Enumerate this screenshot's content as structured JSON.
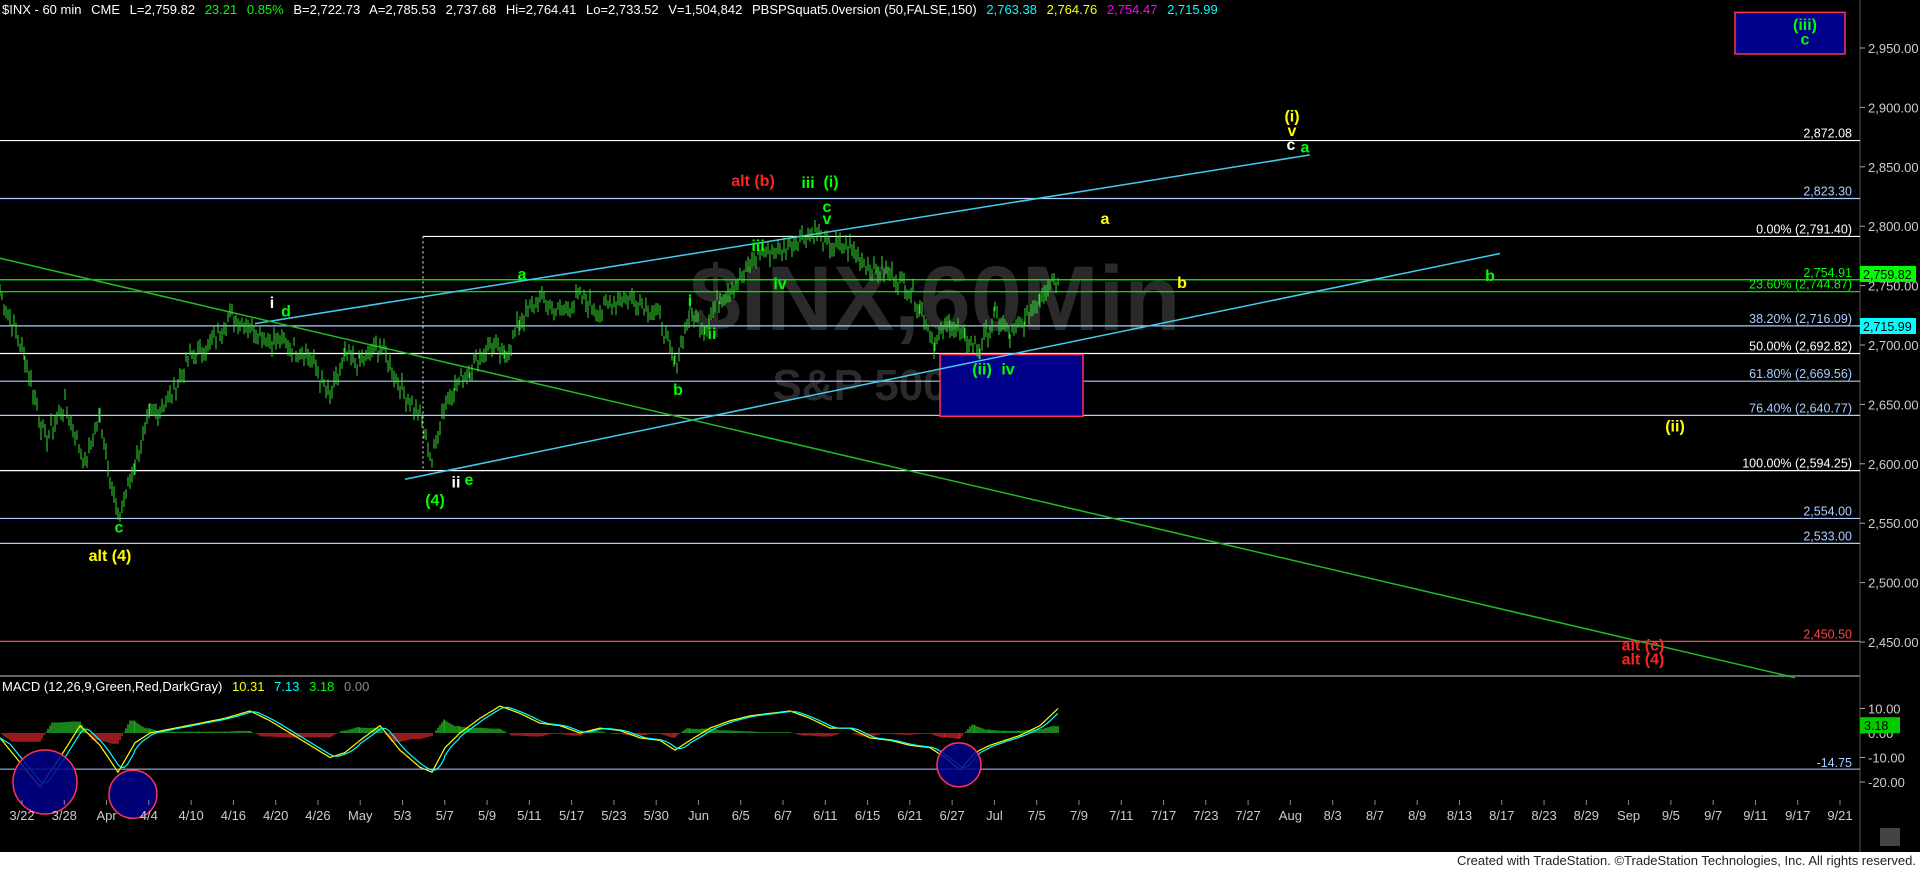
{
  "header": {
    "symbol": "$INX - 60 min",
    "exchange": "CME",
    "last": "L=2,759.82",
    "change": "23.21",
    "change_pct": "0.85%",
    "bid": "B=2,722.73",
    "ask": "A=2,785.53",
    "open": "2,737.68",
    "high": "Hi=2,764.41",
    "low": "Lo=2,733.52",
    "volume": "V=1,504,842",
    "study": "PBSPSquat5.0version (50,FALSE,150)",
    "study_values": [
      "2,763.38",
      "2,764.76",
      "2,754.47",
      "2,715.99"
    ],
    "colors": {
      "symbol": "#ffffff",
      "change": "#00ff00",
      "study1": "#00ffff",
      "study2": "#ffff00",
      "study3": "#ff00ff",
      "study4": "#00ffff"
    }
  },
  "watermark": {
    "line1": "$INX,60Min",
    "line2": "S&P 500"
  },
  "macd_header": {
    "label": "MACD (12,26,9,Green,Red,DarkGray)",
    "values": [
      "10.31",
      "7.13",
      "3.18",
      "0.00"
    ]
  },
  "credit": "Created with TradeStation. ©TradeStation Technologies, Inc. All rights reserved.",
  "chart_data": {
    "type": "line",
    "title": "$INX - 60 min",
    "price_axis": {
      "ticks": [
        2450,
        2500,
        2550,
        2600,
        2650,
        2700,
        2750,
        2800,
        2850,
        2900,
        2950
      ],
      "tick_labels": [
        "2,450.00",
        "2,500.00",
        "2,550.00",
        "2,600.00",
        "2,650.00",
        "2,700.00",
        "2,750.00",
        "2,800.00",
        "2,850.00",
        "2,900.00",
        "2,950.00"
      ],
      "ylim": [
        2435,
        2985
      ]
    },
    "macd_axis": {
      "ticks": [
        10,
        0,
        -10,
        -20
      ],
      "tick_labels": [
        "10.00",
        "0.00",
        "-10.00",
        "-20.00"
      ],
      "ylim": [
        -26,
        14
      ]
    },
    "date_labels": [
      "3/22",
      "3/28",
      "Apr",
      "4/4",
      "4/10",
      "4/16",
      "4/20",
      "4/26",
      "May",
      "5/3",
      "5/7",
      "5/9",
      "5/11",
      "5/17",
      "5/23",
      "5/30",
      "Jun",
      "6/5",
      "6/7",
      "6/11",
      "6/15",
      "6/21",
      "6/27",
      "Jul",
      "7/5",
      "7/9",
      "7/11",
      "7/17",
      "7/23",
      "7/27",
      "Aug",
      "8/3",
      "8/7",
      "8/9",
      "8/13",
      "8/17",
      "8/23",
      "8/29",
      "Sep",
      "9/5",
      "9/7",
      "9/11",
      "9/17",
      "9/21"
    ],
    "price_series": [
      [
        0,
        2745
      ],
      [
        25,
        2690
      ],
      [
        45,
        2620
      ],
      [
        65,
        2650
      ],
      [
        85,
        2600
      ],
      [
        100,
        2640
      ],
      [
        118,
        2553
      ],
      [
        135,
        2600
      ],
      [
        150,
        2640
      ],
      [
        170,
        2655
      ],
      [
        190,
        2690
      ],
      [
        210,
        2700
      ],
      [
        230,
        2725
      ],
      [
        250,
        2716
      ],
      [
        270,
        2705
      ],
      [
        290,
        2700
      ],
      [
        310,
        2690
      ],
      [
        330,
        2655
      ],
      [
        345,
        2690
      ],
      [
        360,
        2685
      ],
      [
        380,
        2700
      ],
      [
        400,
        2665
      ],
      [
        420,
        2640
      ],
      [
        432,
        2602
      ],
      [
        442,
        2645
      ],
      [
        455,
        2665
      ],
      [
        470,
        2680
      ],
      [
        490,
        2700
      ],
      [
        505,
        2690
      ],
      [
        520,
        2720
      ],
      [
        540,
        2740
      ],
      [
        560,
        2727
      ],
      [
        580,
        2740
      ],
      [
        600,
        2728
      ],
      [
        620,
        2740
      ],
      [
        640,
        2738
      ],
      [
        660,
        2722
      ],
      [
        675,
        2682
      ],
      [
        690,
        2728
      ],
      [
        705,
        2715
      ],
      [
        720,
        2740
      ],
      [
        740,
        2755
      ],
      [
        760,
        2778
      ],
      [
        780,
        2780
      ],
      [
        800,
        2790
      ],
      [
        815,
        2795
      ],
      [
        830,
        2782
      ],
      [
        850,
        2782
      ],
      [
        870,
        2765
      ],
      [
        890,
        2760
      ],
      [
        905,
        2752
      ],
      [
        920,
        2732
      ],
      [
        935,
        2700
      ],
      [
        950,
        2720
      ],
      [
        965,
        2705
      ],
      [
        980,
        2697
      ],
      [
        995,
        2725
      ],
      [
        1010,
        2708
      ],
      [
        1025,
        2720
      ],
      [
        1040,
        2742
      ],
      [
        1052,
        2757
      ],
      [
        1058,
        2753
      ]
    ],
    "horizontal_levels": [
      {
        "value": 2872.08,
        "label": "2,872.08",
        "color": "#ffffff"
      },
      {
        "value": 2823.3,
        "label": "2,823.30",
        "color": "#aaccff"
      },
      {
        "value": 2791.4,
        "label": "0.00% (2,791.40)",
        "color": "#ffffff"
      },
      {
        "value": 2754.91,
        "label": "2,754.91",
        "color": "#00ff00"
      },
      {
        "value": 2744.87,
        "label": "23.60% (2,744.87)",
        "color": "#00ff00"
      },
      {
        "value": 2716.09,
        "label": "38.20% (2,716.09)",
        "color": "#aaccff"
      },
      {
        "value": 2692.82,
        "label": "50.00% (2,692.82)",
        "color": "#ffffff"
      },
      {
        "value": 2669.56,
        "label": "61.80% (2,669.56)",
        "color": "#aaccff"
      },
      {
        "value": 2640.77,
        "label": "76.40% (2,640.77)",
        "color": "#aaccff"
      },
      {
        "value": 2594.25,
        "label": "100.00% (2,594.25)",
        "color": "#ffffff"
      },
      {
        "value": 2554.0,
        "label": "2,554.00",
        "color": "#aaccff"
      },
      {
        "value": 2533.0,
        "label": "2,533.00",
        "color": "#aaccff"
      },
      {
        "value": 2450.5,
        "label": "2,450.50",
        "color": "#ff4444"
      }
    ],
    "price_badges": [
      {
        "value": 2759.82,
        "label": "2,759.82",
        "bg": "#00ff00",
        "fg": "#000000"
      },
      {
        "value": 2715.99,
        "label": "2,715.99",
        "bg": "#00ffff",
        "fg": "#000000"
      }
    ],
    "macd_badge": {
      "value": 3.18,
      "label": "3.18"
    },
    "macd_level": {
      "value": -14.75,
      "label": "-14.75"
    },
    "wave_labels": [
      {
        "text": "(iii)",
        "color": "#00ff00",
        "x": 1805,
        "p": 2965
      },
      {
        "text": "c",
        "color": "#00ff00",
        "x": 1805,
        "p": 2953
      },
      {
        "text": "(i)",
        "color": "#ffff00",
        "x": 1292,
        "p": 2888
      },
      {
        "text": "v",
        "color": "#ffff00",
        "x": 1292,
        "p": 2876
      },
      {
        "text": "c",
        "color": "#ffffff",
        "x": 1291,
        "p": 2864
      },
      {
        "text": "a",
        "color": "#00ff00",
        "x": 1305,
        "p": 2862
      },
      {
        "text": "alt (b)",
        "color": "#ff2222",
        "x": 753,
        "p": 2834
      },
      {
        "text": "iii",
        "color": "#00ff00",
        "x": 808,
        "p": 2832
      },
      {
        "text": "(i)",
        "color": "#00ff00",
        "x": 831,
        "p": 2833
      },
      {
        "text": "c",
        "color": "#00ff00",
        "x": 827,
        "p": 2812
      },
      {
        "text": "v",
        "color": "#00ff00",
        "x": 827,
        "p": 2802
      },
      {
        "text": "a",
        "color": "#ffff00",
        "x": 1105,
        "p": 2802
      },
      {
        "text": "iii",
        "color": "#00ff00",
        "x": 758,
        "p": 2779
      },
      {
        "text": "a",
        "color": "#00ff00",
        "x": 522,
        "p": 2755
      },
      {
        "text": "b",
        "color": "#ffff00",
        "x": 1182,
        "p": 2748
      },
      {
        "text": "b",
        "color": "#00ff00",
        "x": 1490,
        "p": 2754
      },
      {
        "text": "iv",
        "color": "#00ff00",
        "x": 780,
        "p": 2747
      },
      {
        "text": "i",
        "color": "#00ff00",
        "x": 690,
        "p": 2733
      },
      {
        "text": "i",
        "color": "#ffffff",
        "x": 272,
        "p": 2731
      },
      {
        "text": "d",
        "color": "#00ff00",
        "x": 286,
        "p": 2724
      },
      {
        "text": "ii",
        "color": "#00ff00",
        "x": 712,
        "p": 2705
      },
      {
        "text": "(ii)",
        "color": "#00ff00",
        "x": 982,
        "p": 2675
      },
      {
        "text": "iv",
        "color": "#00ff00",
        "x": 1008,
        "p": 2675
      },
      {
        "text": "b",
        "color": "#00ff00",
        "x": 678,
        "p": 2658
      },
      {
        "text": "(ii)",
        "color": "#ffff00",
        "x": 1675,
        "p": 2627
      },
      {
        "text": "e",
        "color": "#00ff00",
        "x": 469,
        "p": 2582
      },
      {
        "text": "ii",
        "color": "#ffffff",
        "x": 456,
        "p": 2580
      },
      {
        "text": "(4)",
        "color": "#00ff00",
        "x": 435,
        "p": 2565
      },
      {
        "text": "c",
        "color": "#00ff00",
        "x": 119,
        "p": 2542
      },
      {
        "text": "alt (4)",
        "color": "#ffff00",
        "x": 110,
        "p": 2518
      },
      {
        "text": "alt (c)",
        "color": "#ff2222",
        "x": 1643,
        "p": 2443
      },
      {
        "text": "alt (4)",
        "color": "#ff2222",
        "x": 1643,
        "p": 2431
      }
    ],
    "boxes": [
      {
        "x1": 940,
        "x2": 1083,
        "p1": 2640,
        "p2": 2692,
        "fill": "#00008b",
        "stroke": "#ff3355"
      },
      {
        "x1": 1735,
        "x2": 1845,
        "p1": 2945,
        "p2": 2980,
        "fill": "#00008b",
        "stroke": "#ff3355"
      }
    ],
    "trend_lines": [
      {
        "x1": 255,
        "p1": 2718,
        "x2": 1310,
        "p2": 2860,
        "color": "#44ccee"
      },
      {
        "x1": 405,
        "p1": 2587,
        "x2": 1500,
        "p2": 2777,
        "color": "#44ccee"
      },
      {
        "x1": 0,
        "p1": 2773,
        "x2": 1795,
        "p2": 2420,
        "color": "#22bb22"
      }
    ],
    "macd_series": [
      [
        0,
        -2
      ],
      [
        20,
        -12
      ],
      [
        40,
        -22
      ],
      [
        60,
        -10
      ],
      [
        80,
        3
      ],
      [
        100,
        -5
      ],
      [
        118,
        -16
      ],
      [
        135,
        -4
      ],
      [
        150,
        0
      ],
      [
        175,
        2
      ],
      [
        200,
        4
      ],
      [
        225,
        6
      ],
      [
        250,
        9
      ],
      [
        270,
        5
      ],
      [
        290,
        0
      ],
      [
        310,
        -5
      ],
      [
        330,
        -10
      ],
      [
        345,
        -8
      ],
      [
        360,
        -3
      ],
      [
        380,
        3
      ],
      [
        400,
        -7
      ],
      [
        420,
        -14
      ],
      [
        432,
        -16
      ],
      [
        445,
        -6
      ],
      [
        460,
        0
      ],
      [
        480,
        6
      ],
      [
        500,
        11
      ],
      [
        520,
        8
      ],
      [
        540,
        4
      ],
      [
        560,
        3
      ],
      [
        580,
        0
      ],
      [
        600,
        2
      ],
      [
        620,
        1
      ],
      [
        640,
        -2
      ],
      [
        660,
        -3
      ],
      [
        675,
        -7
      ],
      [
        690,
        -3
      ],
      [
        710,
        2
      ],
      [
        730,
        5
      ],
      [
        750,
        7
      ],
      [
        770,
        8
      ],
      [
        790,
        9
      ],
      [
        810,
        6
      ],
      [
        830,
        2
      ],
      [
        850,
        2
      ],
      [
        870,
        -2
      ],
      [
        890,
        -3
      ],
      [
        910,
        -5
      ],
      [
        930,
        -6
      ],
      [
        945,
        -10
      ],
      [
        960,
        -15
      ],
      [
        975,
        -8
      ],
      [
        990,
        -5
      ],
      [
        1005,
        -3
      ],
      [
        1020,
        -1
      ],
      [
        1040,
        3
      ],
      [
        1058,
        10
      ]
    ],
    "macd_circles": [
      {
        "x": 45,
        "v": -20,
        "r": 32
      },
      {
        "x": 133,
        "v": -25,
        "r": 24
      },
      {
        "x": 959,
        "v": -13,
        "r": 22
      }
    ]
  }
}
